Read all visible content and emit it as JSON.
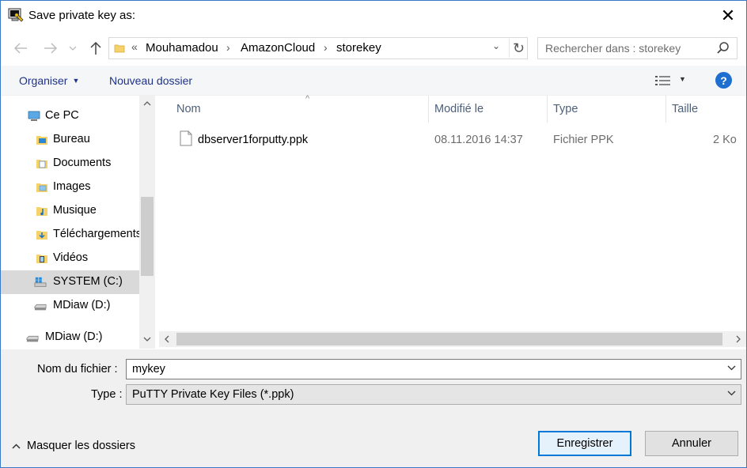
{
  "window": {
    "title": "Save private key as:",
    "close_glyph": "✕"
  },
  "nav": {
    "back_icon": "arrow-left",
    "forward_icon": "arrow-right",
    "recent_icon": "chevron-down",
    "up_icon": "arrow-up",
    "overflow_chevron": "«",
    "breadcrumbs": [
      "Mouhamadou",
      "AmazonCloud",
      "storekey"
    ],
    "search_placeholder": "Rechercher dans : storekey"
  },
  "toolbar": {
    "organize_label": "Organiser",
    "new_folder_label": "Nouveau dossier"
  },
  "tree": {
    "items": [
      {
        "label": "Ce PC",
        "icon": "computer-icon"
      },
      {
        "label": "Bureau",
        "icon": "desktop-folder-icon"
      },
      {
        "label": "Documents",
        "icon": "documents-folder-icon"
      },
      {
        "label": "Images",
        "icon": "images-folder-icon"
      },
      {
        "label": "Musique",
        "icon": "music-folder-icon"
      },
      {
        "label": "Téléchargements",
        "icon": "downloads-folder-icon"
      },
      {
        "label": "Vidéos",
        "icon": "videos-folder-icon"
      },
      {
        "label": "SYSTEM (C:)",
        "icon": "system-drive-icon",
        "selected": true
      },
      {
        "label": "MDiaw (D:)",
        "icon": "drive-icon"
      },
      {
        "label": "MDiaw (D:)",
        "icon": "drive-icon"
      }
    ]
  },
  "files": {
    "columns": [
      "Nom",
      "Modifié le",
      "Type",
      "Taille"
    ],
    "rows": [
      {
        "name": "dbserver1forputty.ppk",
        "modified": "08.11.2016 14:37",
        "type": "Fichier PPK",
        "size": "2 Ko"
      }
    ]
  },
  "form": {
    "filename_label": "Nom du fichier :",
    "filename_value": "mykey",
    "type_label": "Type :",
    "type_value": "PuTTY Private Key Files (*.ppk)"
  },
  "footer": {
    "hide_folders_label": "Masquer les dossiers",
    "save_label": "Enregistrer",
    "cancel_label": "Annuler"
  },
  "colors": {
    "accent": "#0078d7",
    "selected_tree": "#d9d9d9",
    "link_text": "#1e3287"
  }
}
